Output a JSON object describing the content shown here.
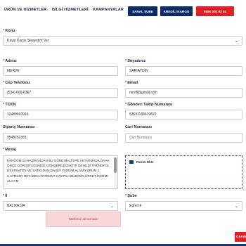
{
  "nav": {
    "links": [
      "ÜRÜN VE HİZMETLER",
      "BİLGİ HİZMETLERİ",
      "KAMPANYALAR"
    ],
    "online_branch": "SANAL ŞUBE",
    "credit_cargo": "KREDİLİ KARGO",
    "phone": "0850 202 02 02"
  },
  "form": {
    "konu_label": "Konu",
    "konu_value": "Kayıp Kargo Şikayetim Var",
    "adiniz_label": "Adınız",
    "adiniz_value": "MERVE",
    "soyadiniz_label": "Soyadınız",
    "soyadiniz_value": "SARIAYDIN",
    "cep_label": "Cep Telefonu",
    "cep_value": "(534) 600-6367",
    "email_label": "Email",
    "email_value": "mrvfll@gmail.com",
    "tckn_label": "TCKN",
    "tckn_value": "12489693916",
    "gonderi_label": "Gönderi Takip Numarası",
    "gonderi_value": "53691184619622",
    "siparis_label": "Sipariş Numarası",
    "siparis_value": "9548752381",
    "cari_label": "Cari Numarası",
    "cari_placeholder": "Cari Numarası",
    "mesaj_label": "Mesaj",
    "mesaj_value": "KARGOM 24 HAZİRANDAN BU GÜNE MALTEPE AKTARMADA DAHA ÖNCE GÖRÜŞTÜĞÜMDE GÖNDERİLECEKTİR DENİLDİ TRENDYOL DESTEKTEN VE SATICIDAN DA BİR YARDIM ALAMIYORUM 2 HAFTADIR NEYİ BEKLİYORUM? KAYIPSA BİLDİRİN ÜCRET İADEMİ ALAYIM",
    "resim_label": "Resim Ekle",
    "il_label": "İl",
    "il_value": "BALIKESİR",
    "sube_label": "Şube",
    "sube_value": "Edremit"
  },
  "alert": {
    "text": "Talebiniz alınamadı!"
  },
  "submit": {
    "label": "Gönder"
  },
  "colors": {
    "navy": "#0b2a6b",
    "red": "#e31e24",
    "alert_bg": "#f8d7da"
  }
}
